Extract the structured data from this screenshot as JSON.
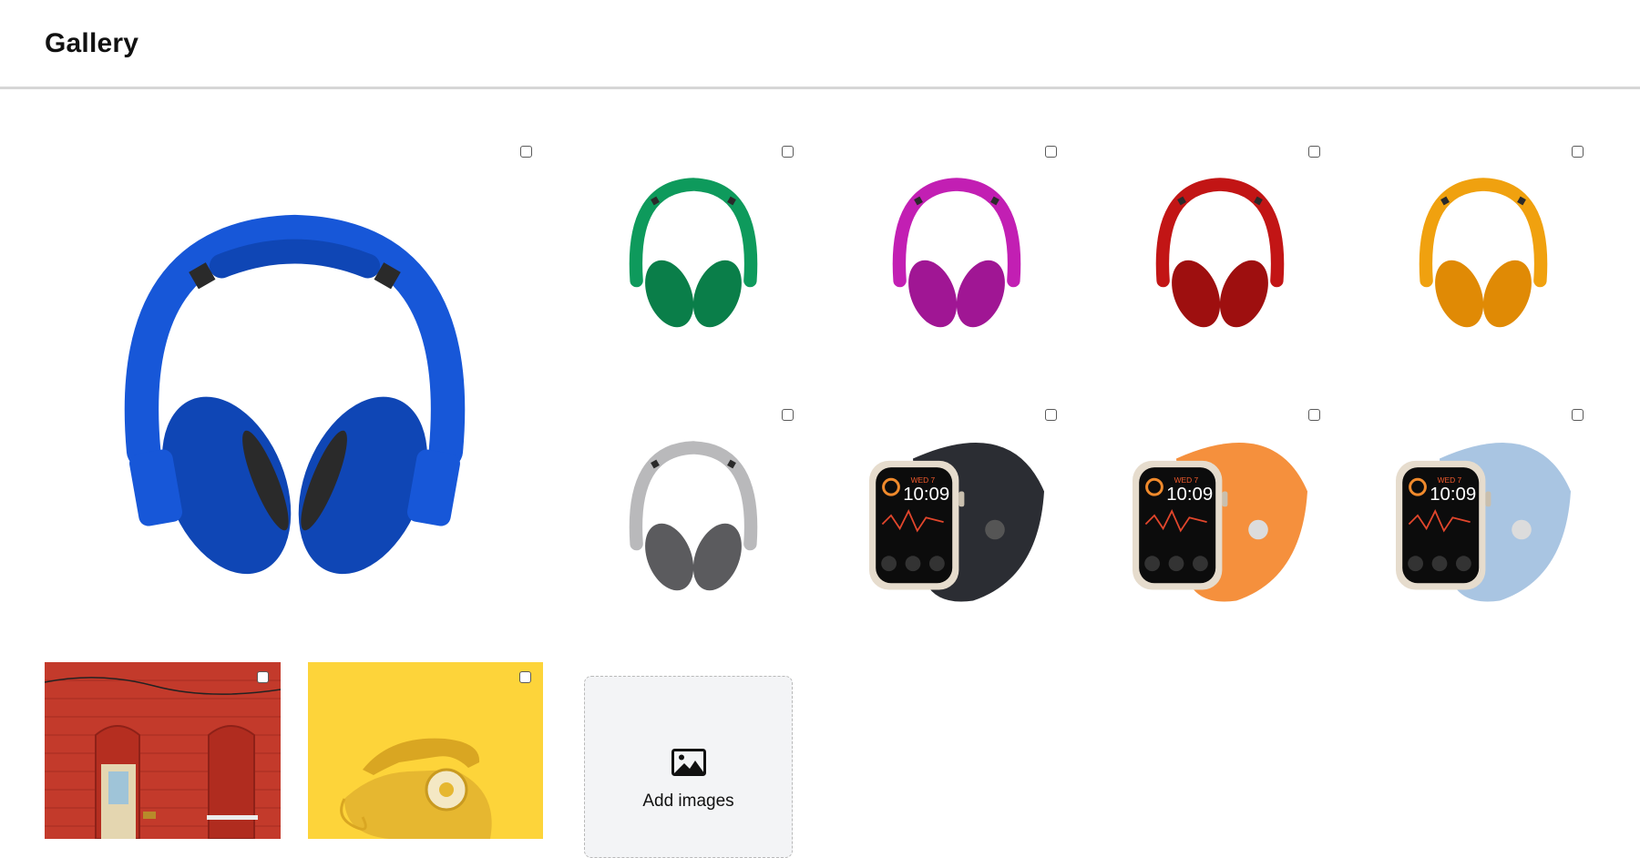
{
  "header": {
    "title": "Gallery"
  },
  "add_tile": {
    "label": "Add images",
    "icon": "image-icon"
  },
  "colors": {
    "blue": "#1757d8",
    "green": "#0e9a5c",
    "magenta": "#c21fb3",
    "red": "#c21515",
    "orange": "#f0a10f",
    "silver": "#b9b9bb",
    "watch_black": "#2b2d33",
    "watch_orange": "#f5903d",
    "watch_lightblue": "#a9c5e2"
  },
  "watch_face": {
    "time": "10:09",
    "day": "WED 7"
  }
}
